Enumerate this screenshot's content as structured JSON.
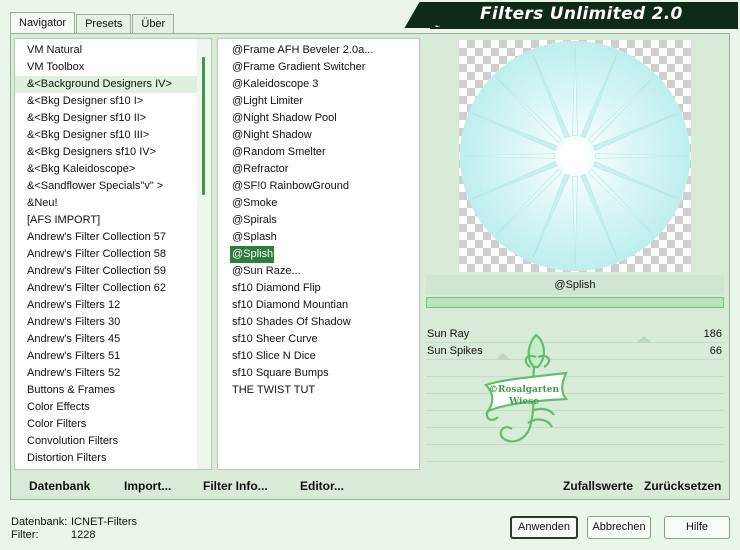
{
  "app": {
    "title": "Filters Unlimited 2.0"
  },
  "tabs": [
    {
      "label": "Navigator",
      "active": true
    },
    {
      "label": "Presets",
      "active": false
    },
    {
      "label": "Über",
      "active": false
    }
  ],
  "categories": {
    "selected_index": 2,
    "items": [
      "VM Natural",
      "VM Toolbox",
      "&<Background Designers IV>",
      "&<Bkg Designer sf10 I>",
      "&<Bkg Designer sf10 II>",
      "&<Bkg Designer sf10 III>",
      "&<Bkg Designers sf10 IV>",
      "&<Bkg Kaleidoscope>",
      "&<Sandflower Specials\"v\" >",
      "&Neu!",
      "[AFS IMPORT]",
      "Andrew's Filter Collection 57",
      "Andrew's Filter Collection 58",
      "Andrew's Filter Collection 59",
      "Andrew's Filter Collection 62",
      "Andrew's Filters 12",
      "Andrew's Filters 30",
      "Andrew's Filters 45",
      "Andrew's Filters 51",
      "Andrew's Filters 52",
      "Buttons & Frames",
      "Color Effects",
      "Color Filters",
      "Convolution Filters",
      "Distortion Filters"
    ]
  },
  "filters": {
    "selected_index": 12,
    "items": [
      "@Frame AFH Beveler 2.0a...",
      "@Frame Gradient Switcher",
      "@Kaleidoscope 3",
      "@Light Limiter",
      "@Night Shadow Pool",
      "@Night Shadow",
      "@Random Smelter",
      "@Refractor",
      "@SF!0 RainbowGround",
      "@Smoke",
      "@Spirals",
      "@Splash",
      "@Splish",
      "@Sun Raze...",
      "sf10 Diamond Flip",
      "sf10 Diamond Mountian",
      "sf10 Shades Of Shadow",
      "sf10 Sheer Curve",
      "sf10 Slice N Dice",
      "sf10 Square Bumps",
      "THE TWIST TUT"
    ]
  },
  "preview": {
    "filter_name": "@Splish",
    "progress_fraction": 1.0
  },
  "params": [
    {
      "label": "Sun Ray",
      "value": "186",
      "fraction": 0.73
    },
    {
      "label": "Sun Spikes",
      "value": "66",
      "fraction": 0.26
    }
  ],
  "watermark": {
    "text_line1": "©Rosalgarten",
    "text_line2": "Wiese"
  },
  "bottom_actions": {
    "datenbank": "Datenbank",
    "import": "Import...",
    "filter_info": "Filter Info...",
    "editor": "Editor...",
    "zufallswerte": "Zufallswerte",
    "zuruecksetzen": "Zurücksetzen"
  },
  "status": {
    "db_label": "Datenbank:",
    "db_value": "ICNET-Filters",
    "filter_label": "Filter:",
    "filter_value": "1228"
  },
  "dialog_buttons": {
    "apply": "Anwenden",
    "cancel": "Abbrechen",
    "help": "Hilfe"
  },
  "colors": {
    "accent": "#2f7d3a",
    "banner": "#0f2a17",
    "background": "#eaf6ea"
  }
}
